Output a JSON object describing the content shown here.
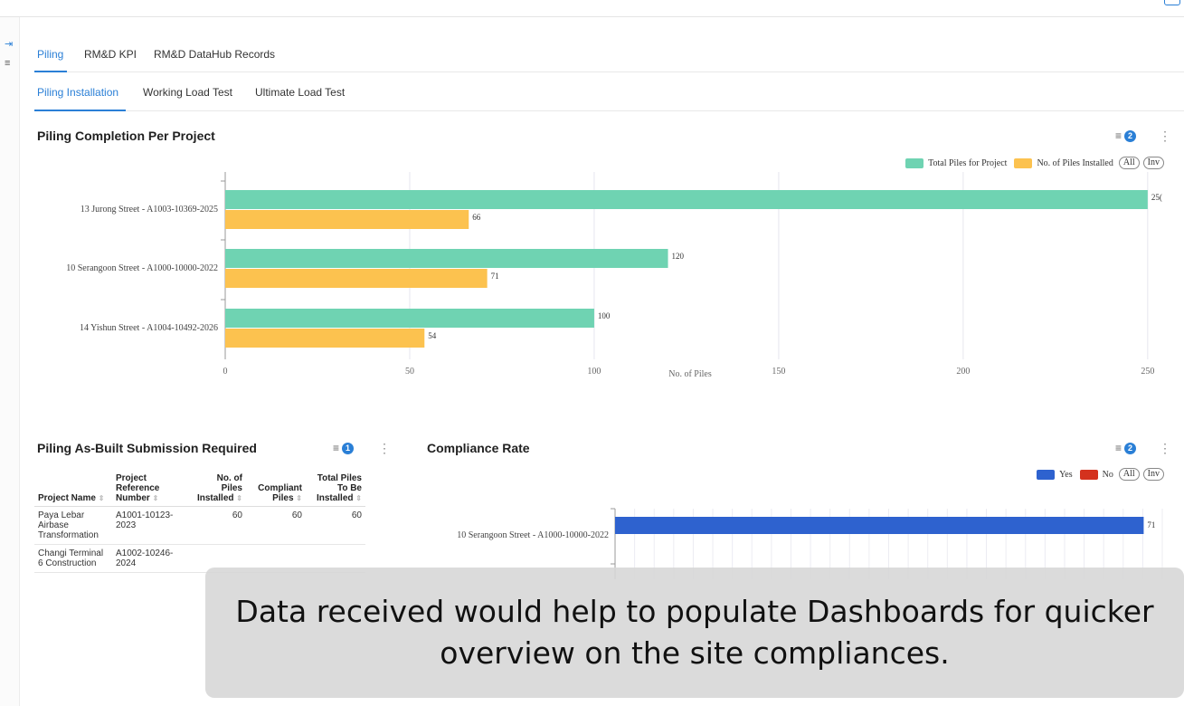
{
  "tabs_primary": [
    {
      "label": "Piling",
      "active": true
    },
    {
      "label": "RM&D KPI",
      "active": false
    },
    {
      "label": "RM&D DataHub Records",
      "active": false
    }
  ],
  "tabs_secondary": [
    {
      "label": "Piling Installation",
      "active": true
    },
    {
      "label": "Working Load Test",
      "active": false
    },
    {
      "label": "Ultimate Load Test",
      "active": false
    }
  ],
  "panel_completion": {
    "title": "Piling Completion Per Project",
    "filter_count": "2",
    "legend_pills": [
      "All",
      "Inv"
    ],
    "chart_data": {
      "type": "bar",
      "orientation": "horizontal",
      "categories": [
        "13 Jurong Street - A1003-10369-2025",
        "10 Serangoon Street - A1000-10000-2022",
        "14 Yishun Street - A1004-10492-2026"
      ],
      "series": [
        {
          "name": "Total Piles for Project",
          "values": [
            250,
            120,
            100
          ],
          "color": "#6fd3b2"
        },
        {
          "name": "No. of Piles Installed",
          "values": [
            66,
            71,
            54
          ],
          "color": "#fcc24f"
        }
      ],
      "data_labels": [
        "25(",
        "120",
        "100",
        "66",
        "71",
        "54"
      ],
      "xlabel": "No. of Piles",
      "xticks": [
        "0",
        "50",
        "100",
        "150",
        "200",
        "250"
      ],
      "xlim": [
        0,
        252
      ],
      "legend_position": "top-right"
    }
  },
  "panel_asbuilt": {
    "title": "Piling As-Built Submission Required",
    "filter_count": "1",
    "columns": [
      "Project Name",
      "Project Reference Number",
      "No. of Piles Installed",
      "Compliant Piles",
      "Total Piles To Be Installed"
    ],
    "rows": [
      [
        "Paya Lebar Airbase Transformation",
        "A1001-10123-2023",
        "60",
        "60",
        "60"
      ],
      [
        "Changi Terminal 6 Construction",
        "A1002-10246-2024",
        "",
        "",
        ""
      ]
    ]
  },
  "panel_compliance": {
    "title": "Compliance Rate",
    "filter_count": "2",
    "legend_pills": [
      "All",
      "Inv"
    ],
    "chart_data": {
      "type": "bar",
      "orientation": "horizontal",
      "categories": [
        "10 Serangoon Street - A1000-10000-2022"
      ],
      "series": [
        {
          "name": "Yes",
          "values": [
            71
          ],
          "color": "#2e62cf"
        },
        {
          "name": "No",
          "values": [],
          "color": "#d4321e"
        }
      ],
      "data_labels": [
        "71"
      ],
      "legend_position": "top-right",
      "grid": true
    }
  },
  "overlay_caption": "Data received would help to populate Dashboards for quicker overview on the site compliances."
}
